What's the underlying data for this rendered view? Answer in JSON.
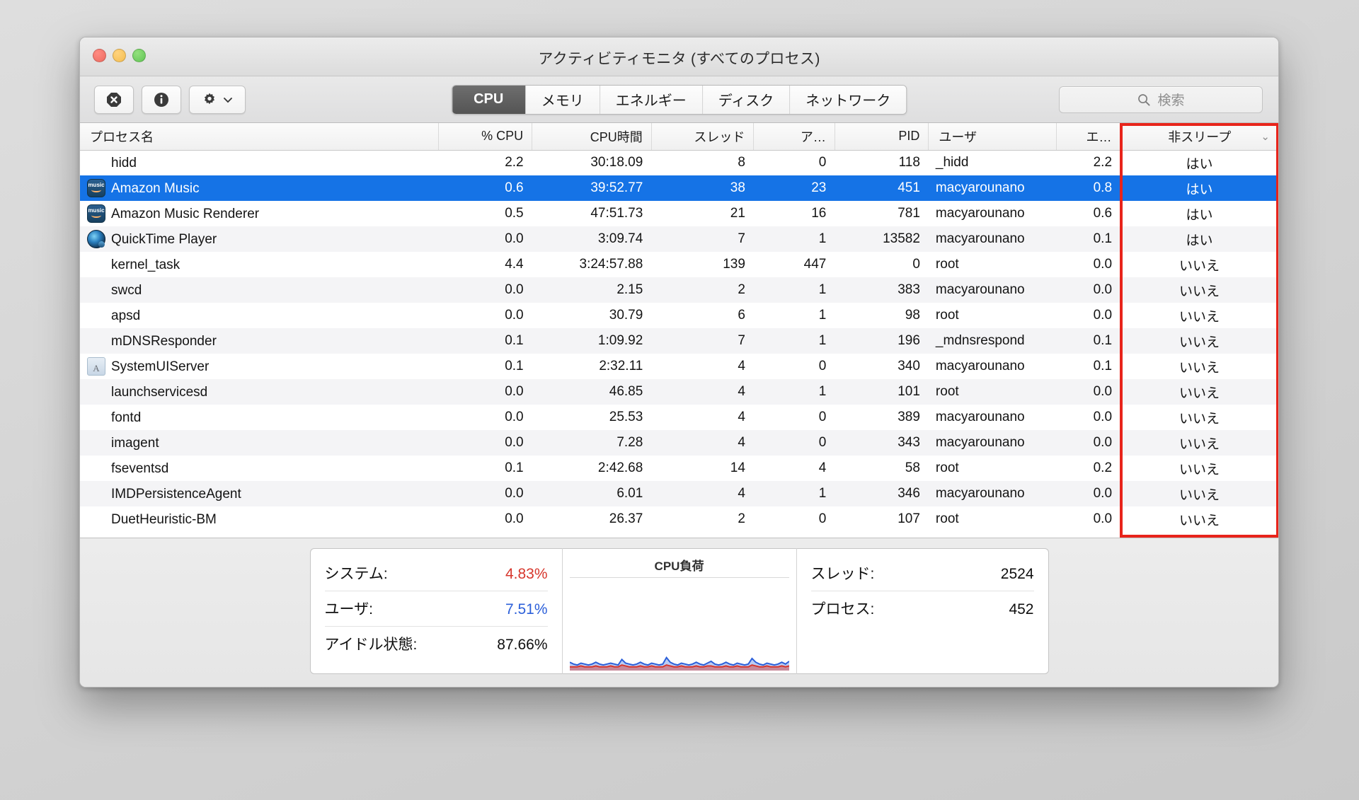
{
  "window": {
    "title": "アクティビティモニタ (すべてのプロセス)",
    "traffic_lights": [
      "close",
      "minimize",
      "zoom"
    ]
  },
  "toolbar": {
    "quit_process_icon": "octagon-x-icon",
    "inspect_icon": "info-circle-icon",
    "settings_icon": "gear-icon",
    "settings_chevron": "⌄",
    "tabs": [
      {
        "label": "CPU",
        "active": true
      },
      {
        "label": "メモリ",
        "active": false
      },
      {
        "label": "エネルギー",
        "active": false
      },
      {
        "label": "ディスク",
        "active": false
      },
      {
        "label": "ネットワーク",
        "active": false
      }
    ],
    "search": {
      "placeholder": "検索",
      "value": "",
      "icon": "search-icon"
    }
  },
  "table": {
    "columns": [
      {
        "key": "name",
        "label": "プロセス名",
        "align": "left"
      },
      {
        "key": "cpu",
        "label": "% CPU",
        "align": "right"
      },
      {
        "key": "cputime",
        "label": "CPU時間",
        "align": "right"
      },
      {
        "key": "threads",
        "label": "スレッド",
        "align": "right"
      },
      {
        "key": "ports",
        "label": "ア…",
        "align": "right"
      },
      {
        "key": "pid",
        "label": "PID",
        "align": "right"
      },
      {
        "key": "user",
        "label": "ユーザ",
        "align": "left"
      },
      {
        "key": "energy",
        "label": "エ…",
        "align": "right"
      },
      {
        "key": "nonsleep",
        "label": "非スリープ",
        "align": "center",
        "sorted": true,
        "sort_chevron": "⌄"
      }
    ],
    "rows": [
      {
        "name": "hidd",
        "icon": "",
        "cpu": "2.2",
        "cputime": "30:18.09",
        "threads": "8",
        "ports": "0",
        "pid": "118",
        "user": "_hidd",
        "energy": "2.2",
        "nonsleep": "はい",
        "selected": false
      },
      {
        "name": "Amazon Music",
        "icon": "amazon-music-icon",
        "cpu": "0.6",
        "cputime": "39:52.77",
        "threads": "38",
        "ports": "23",
        "pid": "451",
        "user": "macyarounano",
        "energy": "0.8",
        "nonsleep": "はい",
        "selected": true
      },
      {
        "name": "Amazon Music Renderer",
        "icon": "amazon-music-icon",
        "cpu": "0.5",
        "cputime": "47:51.73",
        "threads": "21",
        "ports": "16",
        "pid": "781",
        "user": "macyarounano",
        "energy": "0.6",
        "nonsleep": "はい",
        "selected": false
      },
      {
        "name": "QuickTime Player",
        "icon": "quicktime-icon",
        "cpu": "0.0",
        "cputime": "3:09.74",
        "threads": "7",
        "ports": "1",
        "pid": "13582",
        "user": "macyarounano",
        "energy": "0.1",
        "nonsleep": "はい",
        "selected": false
      },
      {
        "name": "kernel_task",
        "icon": "",
        "cpu": "4.4",
        "cputime": "3:24:57.88",
        "threads": "139",
        "ports": "447",
        "pid": "0",
        "user": "root",
        "energy": "0.0",
        "nonsleep": "いいえ",
        "selected": false
      },
      {
        "name": "swcd",
        "icon": "",
        "cpu": "0.0",
        "cputime": "2.15",
        "threads": "2",
        "ports": "1",
        "pid": "383",
        "user": "macyarounano",
        "energy": "0.0",
        "nonsleep": "いいえ",
        "selected": false
      },
      {
        "name": "apsd",
        "icon": "",
        "cpu": "0.0",
        "cputime": "30.79",
        "threads": "6",
        "ports": "1",
        "pid": "98",
        "user": "root",
        "energy": "0.0",
        "nonsleep": "いいえ",
        "selected": false
      },
      {
        "name": "mDNSResponder",
        "icon": "",
        "cpu": "0.1",
        "cputime": "1:09.92",
        "threads": "7",
        "ports": "1",
        "pid": "196",
        "user": "_mdnsrespond",
        "energy": "0.1",
        "nonsleep": "いいえ",
        "selected": false
      },
      {
        "name": "SystemUIServer",
        "icon": "systemuiserver-icon",
        "cpu": "0.1",
        "cputime": "2:32.11",
        "threads": "4",
        "ports": "0",
        "pid": "340",
        "user": "macyarounano",
        "energy": "0.1",
        "nonsleep": "いいえ",
        "selected": false
      },
      {
        "name": "launchservicesd",
        "icon": "",
        "cpu": "0.0",
        "cputime": "46.85",
        "threads": "4",
        "ports": "1",
        "pid": "101",
        "user": "root",
        "energy": "0.0",
        "nonsleep": "いいえ",
        "selected": false
      },
      {
        "name": "fontd",
        "icon": "",
        "cpu": "0.0",
        "cputime": "25.53",
        "threads": "4",
        "ports": "0",
        "pid": "389",
        "user": "macyarounano",
        "energy": "0.0",
        "nonsleep": "いいえ",
        "selected": false
      },
      {
        "name": "imagent",
        "icon": "",
        "cpu": "0.0",
        "cputime": "7.28",
        "threads": "4",
        "ports": "0",
        "pid": "343",
        "user": "macyarounano",
        "energy": "0.0",
        "nonsleep": "いいえ",
        "selected": false
      },
      {
        "name": "fseventsd",
        "icon": "",
        "cpu": "0.1",
        "cputime": "2:42.68",
        "threads": "14",
        "ports": "4",
        "pid": "58",
        "user": "root",
        "energy": "0.2",
        "nonsleep": "いいえ",
        "selected": false
      },
      {
        "name": "IMDPersistenceAgent",
        "icon": "",
        "cpu": "0.0",
        "cputime": "6.01",
        "threads": "4",
        "ports": "1",
        "pid": "346",
        "user": "macyarounano",
        "energy": "0.0",
        "nonsleep": "いいえ",
        "selected": false
      },
      {
        "name": "DuetHeuristic-BM",
        "icon": "",
        "cpu": "0.0",
        "cputime": "26.37",
        "threads": "2",
        "ports": "0",
        "pid": "107",
        "user": "root",
        "energy": "0.0",
        "nonsleep": "いいえ",
        "selected": false
      }
    ],
    "annotation": {
      "highlight_column": "非スリープ",
      "highlight_color": "#e8241b"
    }
  },
  "footer": {
    "cpu_stats": [
      {
        "label": "システム:",
        "value": "4.83%",
        "color": "red"
      },
      {
        "label": "ユーザ:",
        "value": "7.51%",
        "color": "blue"
      },
      {
        "label": "アイドル状態:",
        "value": "87.66%",
        "color": "black"
      }
    ],
    "graph": {
      "title": "CPU負荷"
    },
    "counts": [
      {
        "label": "スレッド:",
        "value": "2524"
      },
      {
        "label": "プロセス:",
        "value": "452"
      }
    ]
  },
  "chart_data": {
    "type": "area",
    "title": "CPU負荷",
    "xlabel": "",
    "ylabel": "",
    "ylim": [
      0,
      100
    ],
    "grid": false,
    "legend": "none",
    "series": [
      {
        "name": "ユーザ",
        "color": "#2b5fd9",
        "values": [
          9,
          7,
          6,
          8,
          7,
          6,
          7,
          9,
          7,
          6,
          7,
          8,
          7,
          6,
          12,
          8,
          7,
          6,
          7,
          9,
          7,
          6,
          8,
          7,
          6,
          7,
          14,
          9,
          7,
          6,
          8,
          7,
          6,
          7,
          9,
          7,
          6,
          8,
          10,
          7,
          6,
          7,
          9,
          7,
          6,
          8,
          7,
          6,
          7,
          13,
          9,
          7,
          6,
          8,
          7,
          6,
          7,
          9,
          7,
          10
        ]
      },
      {
        "name": "システム",
        "color": "#d7362c",
        "values": [
          4,
          4,
          4,
          5,
          4,
          4,
          4,
          5,
          4,
          4,
          4,
          5,
          4,
          4,
          6,
          5,
          4,
          4,
          4,
          5,
          4,
          4,
          5,
          4,
          4,
          4,
          6,
          5,
          4,
          4,
          5,
          4,
          4,
          4,
          5,
          4,
          4,
          5,
          5,
          4,
          4,
          4,
          5,
          4,
          4,
          5,
          4,
          4,
          4,
          6,
          5,
          4,
          4,
          5,
          4,
          4,
          4,
          5,
          4,
          5
        ]
      }
    ]
  }
}
